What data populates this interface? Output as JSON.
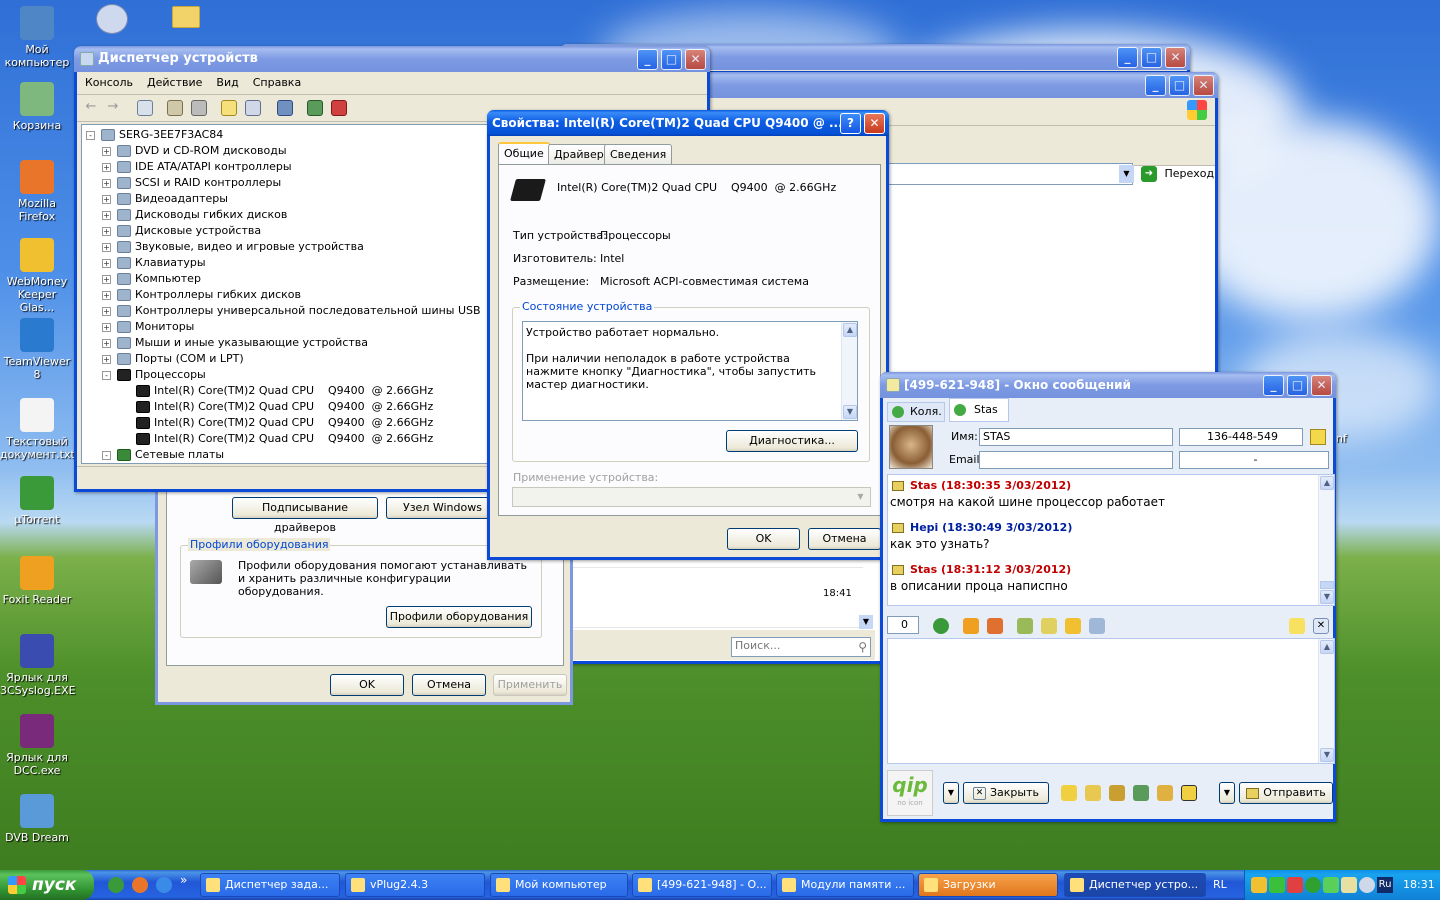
{
  "desktop": {
    "icons": [
      {
        "name": "my-computer-desktop-icon",
        "label": "Мой компьютер",
        "color": "#4f86c6"
      },
      {
        "name": "recycle-bin-desktop-icon",
        "label": "Корзина",
        "color": "#7fb87f"
      },
      {
        "name": "firefox-desktop-icon",
        "label": "Mozilla Firefox",
        "color": "#e8752a"
      },
      {
        "name": "webmoney-desktop-icon",
        "label": "WebMoney Keeper Glas...",
        "color": "#f0c030"
      },
      {
        "name": "teamviewer-desktop-icon",
        "label": "TeamViewer 8",
        "color": "#2a7ad0"
      },
      {
        "name": "text-document-desktop-icon",
        "label": "Текстовый документ.txt",
        "color": "#f4f4f4"
      },
      {
        "name": "utorrent-desktop-icon",
        "label": "µTorrent",
        "color": "#3a9a3a"
      },
      {
        "name": "foxit-reader-desktop-icon",
        "label": "Foxit Reader",
        "color": "#f0a020"
      },
      {
        "name": "3csyslog-shortcut-icon",
        "label": "Ярлык для 3CSyslog.EXE",
        "color": "#3a4cb0"
      },
      {
        "name": "dcc-shortcut-icon",
        "label": "Ярлык для DCC.exe",
        "color": "#7a2a7a"
      },
      {
        "name": "dvb-dream-desktop-icon",
        "label": "DVB Dream",
        "color": "#5a9ad8"
      }
    ]
  },
  "device_manager": {
    "title": "Диспетчер устройств",
    "menu": [
      "Консоль",
      "Действие",
      "Вид",
      "Справка"
    ],
    "root": "SERG-3EE7F3AC84",
    "categories": [
      "DVD и CD-ROM дисководы",
      "IDE ATA/ATAPI контроллеры",
      "SCSI и RAID контроллеры",
      "Видеоадаптеры",
      "Дисководы гибких дисков",
      "Дисковые устройства",
      "Звуковые, видео и игровые устройства",
      "Клавиатуры",
      "Компьютер",
      "Контроллеры гибких дисков",
      "Контроллеры универсальной последовательной шины USB",
      "Мониторы",
      "Мыши и иные указывающие устройства",
      "Порты (COM и LPT)"
    ],
    "processors_label": "Процессоры",
    "cpus": [
      "Intel(R) Core(TM)2 Quad CPU    Q9400  @ 2.66GHz",
      "Intel(R) Core(TM)2 Quad CPU    Q9400  @ 2.66GHz",
      "Intel(R) Core(TM)2 Quad CPU    Q9400  @ 2.66GHz",
      "Intel(R) Core(TM)2 Quad CPU    Q9400  @ 2.66GHz"
    ],
    "network_label": "Сетевые платы",
    "expand_plus": "+",
    "expand_minus": "-"
  },
  "system_props": {
    "driver_signing_btn": "Подписывание драйверов",
    "windows_update_btn": "Узел Windows Up",
    "hw_profiles_group": "Профили оборудования",
    "hw_profiles_text": "Профили оборудования помогают устанавливать и хранить различные конфигурации оборудования.",
    "hw_profiles_btn": "Профили оборудования",
    "ok": "OK",
    "cancel": "Отмена",
    "apply": "Применить"
  },
  "explorer": {
    "go_label": "Переход",
    "time": "18:41",
    "search_placeholder": "Поиск..."
  },
  "props_dialog": {
    "title": "Свойства: Intel(R) Core(TM)2 Quad CPU    Q9400  @ ...",
    "help": "?",
    "tabs": [
      "Общие",
      "Драйвер",
      "Сведения"
    ],
    "device_name": "Intel(R) Core(TM)2 Quad CPU    Q9400  @ 2.66GHz",
    "type_label": "Тип устройства:",
    "type_value": "Процессоры",
    "mfr_label": "Изготовитель:",
    "mfr_value": "Intel",
    "location_label": "Размещение:",
    "location_value": "Microsoft ACPI-совместимая система",
    "status_group": "Состояние устройства",
    "status_line1": "Устройство работает нормально.",
    "status_line2": "При наличии неполадок в работе устройства нажмите кнопку \"Диагностика\", чтобы запустить мастер диагностики.",
    "diag_btn": "Диагностика...",
    "usage_label": "Применение устройства:",
    "ok": "OK",
    "cancel": "Отмена"
  },
  "qip": {
    "title": "[499-621-948] - Окно сообщений",
    "tabs": [
      "Коля.",
      "Stas"
    ],
    "name_label": "Имя:",
    "name_value": "STAS",
    "uin_value": "136-448-549",
    "email_label": "Email:",
    "email_value": "-",
    "messages": [
      {
        "who": "Stas (18:30:35 3/03/2012)",
        "text": "смотря на какой шине процессор работает",
        "color": "#c00000"
      },
      {
        "who": "Hepi (18:30:49 3/03/2012)",
        "text": "как это узнать?",
        "color": "#0020a0"
      },
      {
        "who": "Stas (18:31:12 3/03/2012)",
        "text": "в описании проца написпно",
        "color": "#c00000"
      }
    ],
    "counter": "0",
    "close_btn": "Закрыть",
    "send_btn": "Отправить",
    "logo": "qip",
    "logo_sub": "no icon"
  },
  "taskbar": {
    "start": "пуск",
    "tasks": [
      {
        "label": "Диспетчер зада...",
        "state": "normal"
      },
      {
        "label": "vPlug2.4.3",
        "state": "normal"
      },
      {
        "label": "Мой компьютер",
        "state": "normal"
      },
      {
        "label": "[499-621-948] - О...",
        "state": "normal"
      },
      {
        "label": "Модули памяти ...",
        "state": "normal"
      },
      {
        "label": "Загрузки",
        "state": "orange"
      },
      {
        "label": "Диспетчер устро...",
        "state": "active"
      }
    ],
    "lang": "RL",
    "lang2": "Ru",
    "clock": "18:31",
    "more": "»"
  },
  "truncated_label": "nf"
}
